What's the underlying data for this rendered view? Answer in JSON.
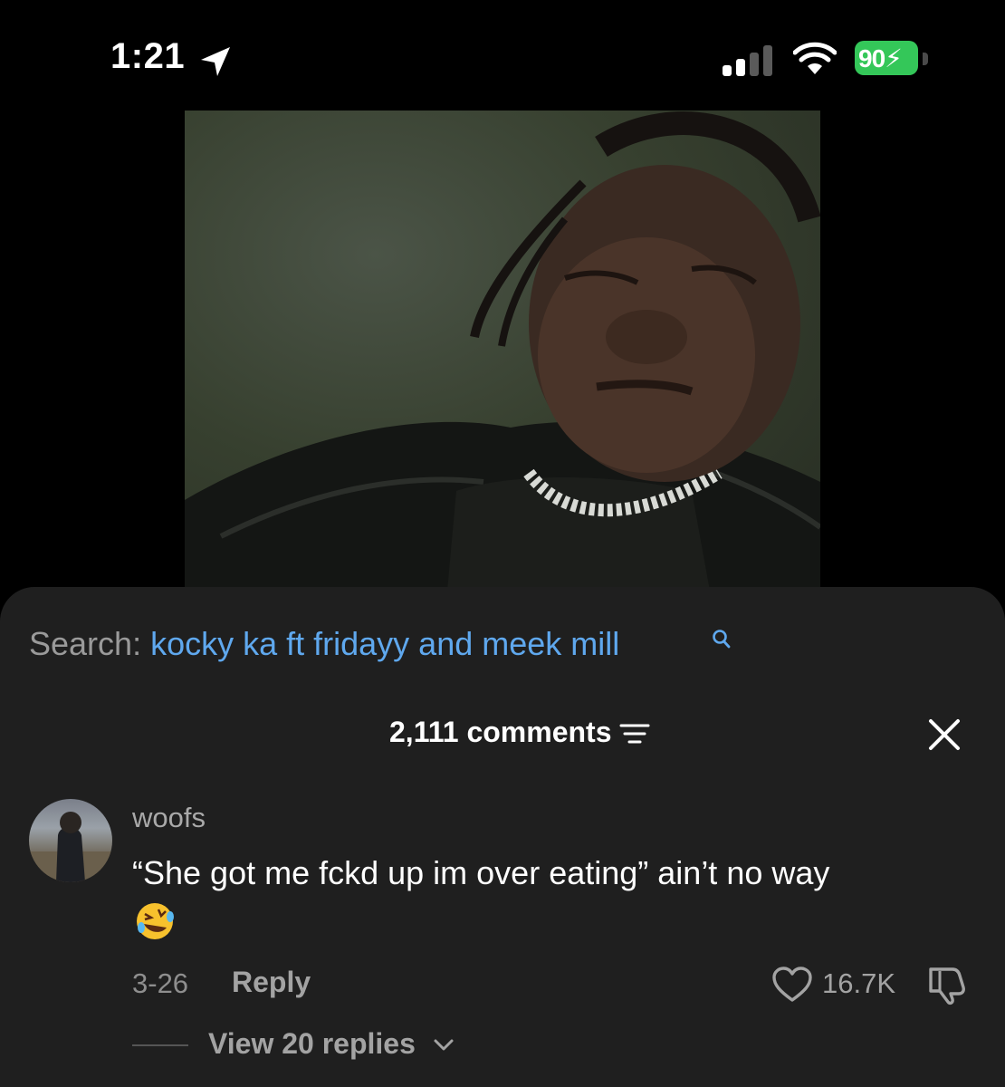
{
  "status_bar": {
    "time": "1:21",
    "battery": "90",
    "battery_color": "#34c759"
  },
  "cover": {
    "icon": "album-cover-image"
  },
  "search": {
    "label": "Search:",
    "query": "kocky ka ft fridayy and meek mill",
    "query_color": "#5fa8ee"
  },
  "comments": {
    "count_label": "2,111 comments"
  },
  "comment": {
    "username": "woofs",
    "text": "“She got me fckd up im over eating” ain’t no way",
    "emoji": "🤣",
    "date": "3-26",
    "reply_label": "Reply",
    "likes": "16.7K",
    "view_replies_label": "View 20 replies"
  }
}
